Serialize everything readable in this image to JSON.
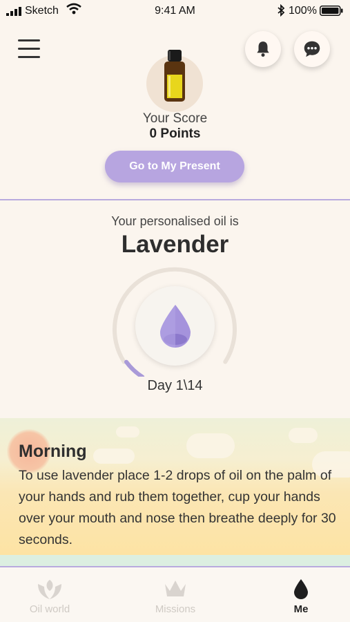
{
  "status_bar": {
    "carrier": "Sketch",
    "time": "9:41 AM",
    "battery_percent": "100%"
  },
  "score": {
    "label": "Your Score",
    "points": "0 Points"
  },
  "present_button_label": "Go to My Present",
  "personalised": {
    "intro": "Your personalised oil is",
    "oil_name": "Lavender",
    "day_label": "Day 1\\14",
    "progress_fraction": 0.0714
  },
  "morning": {
    "title": "Morning",
    "text": "To use lavender place 1-2 drops of oil on the palm of your hands and rub them together, cup your hands over your mouth and nose then breathe deeply for 30 seconds."
  },
  "tabs": [
    {
      "label": "Oil world",
      "icon": "hands-leaf-icon",
      "active": false
    },
    {
      "label": "Missions",
      "icon": "crown-icon",
      "active": false
    },
    {
      "label": "Me",
      "icon": "oil-drop-icon",
      "active": true
    }
  ],
  "colors": {
    "accent": "#b7a5e0",
    "background": "#fbf5ee",
    "drop": "#a593dc"
  }
}
